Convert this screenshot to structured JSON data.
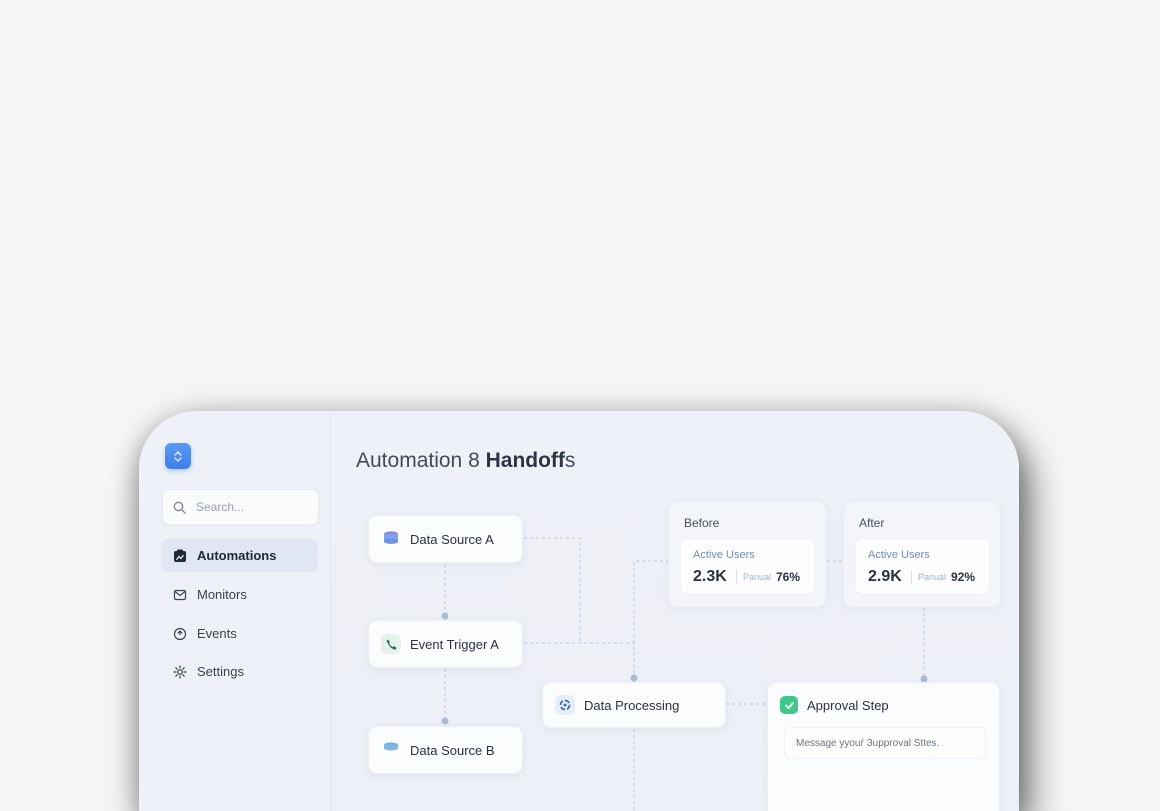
{
  "search": {
    "placeholder": "Search..."
  },
  "sidebar": {
    "items": [
      {
        "label": "Automations",
        "icon": "automations-icon",
        "active": true
      },
      {
        "label": "Monitors",
        "icon": "mail-icon",
        "active": false
      },
      {
        "label": "Events",
        "icon": "events-icon",
        "active": false
      },
      {
        "label": "Settings",
        "icon": "gear-icon",
        "active": false
      }
    ]
  },
  "header": {
    "title_prefix": "Automation 8 ",
    "title_bold": "Handoff",
    "title_suffix": "s"
  },
  "flow": {
    "nodes": {
      "data_source_a": "Data Source A",
      "event_trigger_a": "Event Trigger A",
      "data_processing": "Data Processing",
      "approval_step": "Approval Step",
      "data_source_b": "Data Source B"
    },
    "approval_message": "Message yyouŕ Зupproval Sttes.",
    "before": {
      "label": "Before",
      "stat_label": "Active Users",
      "value": "2.3K",
      "tag": "Panual",
      "percent": "76%"
    },
    "after": {
      "label": "After",
      "stat_label": "Active Users",
      "value": "2.9K",
      "tag": "Panual",
      "percent": "92%"
    }
  },
  "colors": {
    "accent": "#3f7ee8",
    "active_nav_bg": "#e1e7f2",
    "success": "#3ec98a",
    "connector": "#aebfd9"
  }
}
